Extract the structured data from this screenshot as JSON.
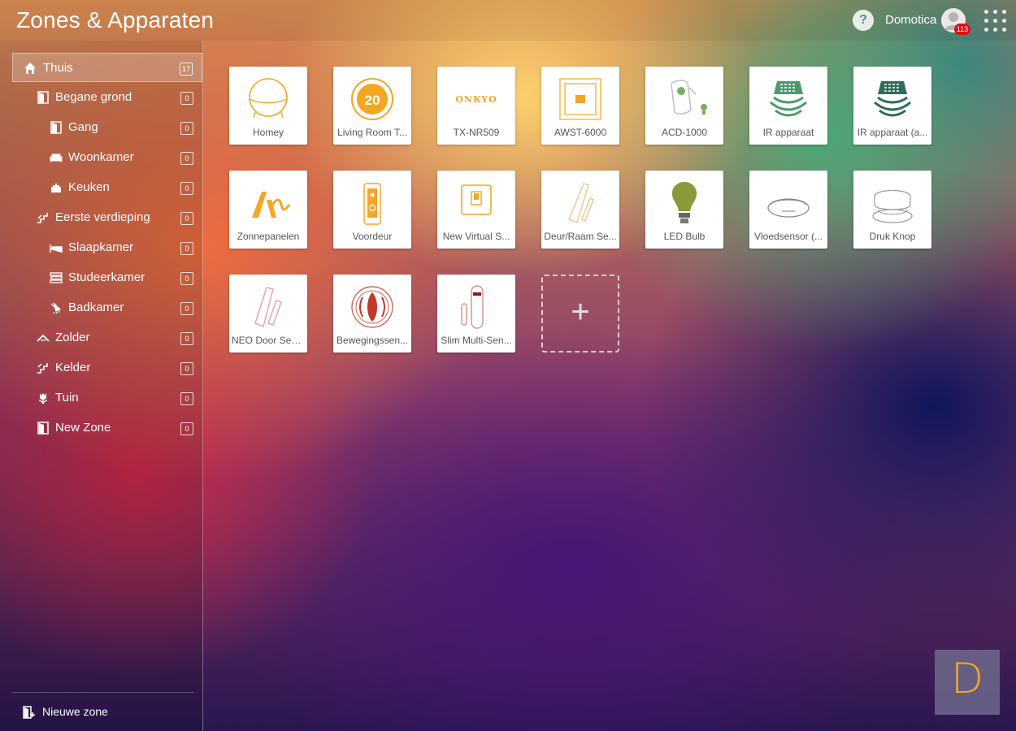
{
  "header": {
    "title": "Zones & Apparaten",
    "help_label": "?",
    "username": "Domotica",
    "notification_count": "113"
  },
  "sidebar": {
    "zones": [
      {
        "label": "Thuis",
        "count": "17",
        "icon": "home-icon",
        "active": true
      },
      {
        "label": "Begane grond",
        "count": "0",
        "icon": "door-icon"
      },
      {
        "label": "Gang",
        "count": "0",
        "icon": "door-icon"
      },
      {
        "label": "Woonkamer",
        "count": "0",
        "icon": "sofa-icon"
      },
      {
        "label": "Keuken",
        "count": "0",
        "icon": "pot-icon"
      },
      {
        "label": "Eerste verdieping",
        "count": "0",
        "icon": "stairs-icon"
      },
      {
        "label": "Slaapkamer",
        "count": "0",
        "icon": "bed-icon"
      },
      {
        "label": "Studeerkamer",
        "count": "0",
        "icon": "books-icon"
      },
      {
        "label": "Badkamer",
        "count": "0",
        "icon": "shower-icon"
      },
      {
        "label": "Zolder",
        "count": "0",
        "icon": "roof-icon"
      },
      {
        "label": "Kelder",
        "count": "0",
        "icon": "stairs-down-icon"
      },
      {
        "label": "Tuin",
        "count": "0",
        "icon": "tulip-icon"
      },
      {
        "label": "New Zone",
        "count": "0",
        "icon": "door-icon"
      }
    ],
    "new_zone_label": "Nieuwe zone"
  },
  "devices": [
    {
      "label": "Homey",
      "icon": "homey-icon"
    },
    {
      "label": "Living Room T...",
      "icon": "thermostat-icon",
      "icon_text": "20"
    },
    {
      "label": "TX-NR509",
      "icon": "onkyo-logo-icon",
      "icon_text": "ONKYO"
    },
    {
      "label": "AWST-6000",
      "icon": "wall-switch-icon"
    },
    {
      "label": "ACD-1000",
      "icon": "plug-dimmer-icon"
    },
    {
      "label": "IR apparaat",
      "icon": "ir-blaster-icon"
    },
    {
      "label": "IR apparaat (a...",
      "icon": "ir-blaster-icon"
    },
    {
      "label": "Zonnepanelen",
      "icon": "solar-icon"
    },
    {
      "label": "Voordeur",
      "icon": "doorbell-icon"
    },
    {
      "label": "New Virtual S...",
      "icon": "virtual-switch-icon"
    },
    {
      "label": "Deur/Raam Se...",
      "icon": "door-sensor-icon"
    },
    {
      "label": "LED Bulb",
      "icon": "bulb-icon"
    },
    {
      "label": "Vloedsensor (...",
      "icon": "flood-sensor-icon"
    },
    {
      "label": "Druk Knop",
      "icon": "button-icon"
    },
    {
      "label": "NEO Door Sen...",
      "icon": "door-sensor-icon"
    },
    {
      "label": "Bewegingssen...",
      "icon": "motion-sensor-icon"
    },
    {
      "label": "Slim Multi-Sen...",
      "icon": "multi-sensor-icon"
    }
  ],
  "add_device_label": "+",
  "corner_logo_letter": "D",
  "colors": {
    "accent": "#f5a623",
    "green": "#4c9a6c",
    "dark_green": "#2e6d58",
    "olive": "#8a9a3a"
  }
}
